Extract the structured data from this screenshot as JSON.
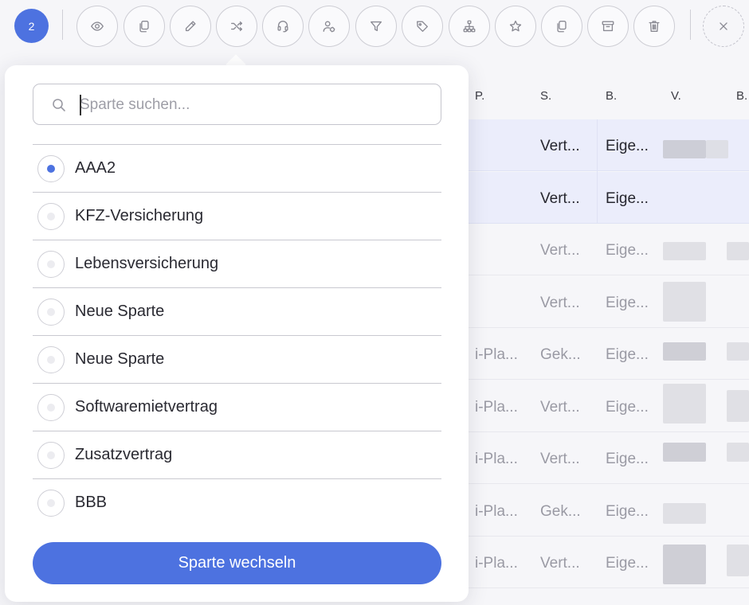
{
  "toolbar": {
    "selected_count": "2",
    "buttons": [
      {
        "icon": "eye-icon",
        "label": "view"
      },
      {
        "icon": "copy-icon",
        "label": "copy"
      },
      {
        "icon": "pencil-icon",
        "label": "edit"
      },
      {
        "icon": "shuffle-icon",
        "label": "change-sparte"
      },
      {
        "icon": "headset-icon",
        "label": "support"
      },
      {
        "icon": "user-tag-icon",
        "label": "assign-user"
      },
      {
        "icon": "filter-icon",
        "label": "filter"
      },
      {
        "icon": "tag-icon",
        "label": "tag"
      },
      {
        "icon": "hierarchy-icon",
        "label": "hierarchy"
      },
      {
        "icon": "star-icon",
        "label": "favorite"
      },
      {
        "icon": "duplicate-icon",
        "label": "duplicate"
      },
      {
        "icon": "archive-icon",
        "label": "archive"
      },
      {
        "icon": "trash-icon",
        "label": "delete"
      },
      {
        "icon": "close-icon",
        "label": "close"
      }
    ]
  },
  "table": {
    "headers": [
      "P.",
      "S.",
      "B.",
      "V.",
      "B."
    ],
    "rows": [
      {
        "p": "",
        "s": "Vert...",
        "b": "Eige...",
        "selected": true
      },
      {
        "p": "",
        "s": "Vert...",
        "b": "Eige...",
        "selected": true
      },
      {
        "p": "",
        "s": "Vert...",
        "b": "Eige...",
        "selected": false
      },
      {
        "p": "",
        "s": "Vert...",
        "b": "Eige...",
        "selected": false
      },
      {
        "p": "i-Pla...",
        "s": "Gek...",
        "b": "Eige...",
        "selected": false
      },
      {
        "p": "i-Pla...",
        "s": "Vert...",
        "b": "Eige...",
        "selected": false
      },
      {
        "p": "i-Pla...",
        "s": "Vert...",
        "b": "Eige...",
        "selected": false
      },
      {
        "p": "i-Pla...",
        "s": "Gek...",
        "b": "Eige...",
        "selected": false
      },
      {
        "p": "i-Pla...",
        "s": "Vert...",
        "b": "Eige...",
        "selected": false
      }
    ]
  },
  "popup": {
    "search": {
      "placeholder": "Sparte suchen...",
      "value": ""
    },
    "options": [
      {
        "label": "AAA2",
        "checked": true
      },
      {
        "label": "KFZ-Versicherung",
        "checked": false
      },
      {
        "label": "Lebensversicherung",
        "checked": false
      },
      {
        "label": "Neue Sparte",
        "checked": false
      },
      {
        "label": "Neue Sparte",
        "checked": false
      },
      {
        "label": "Softwaremietvertrag",
        "checked": false
      },
      {
        "label": "Zusatzvertrag",
        "checked": false
      },
      {
        "label": "BBB",
        "checked": false
      }
    ],
    "submit_label": "Sparte wechseln"
  },
  "colors": {
    "accent": "#4d72e0",
    "selected_row": "#ebedfb",
    "background": "#f6f6f9"
  }
}
